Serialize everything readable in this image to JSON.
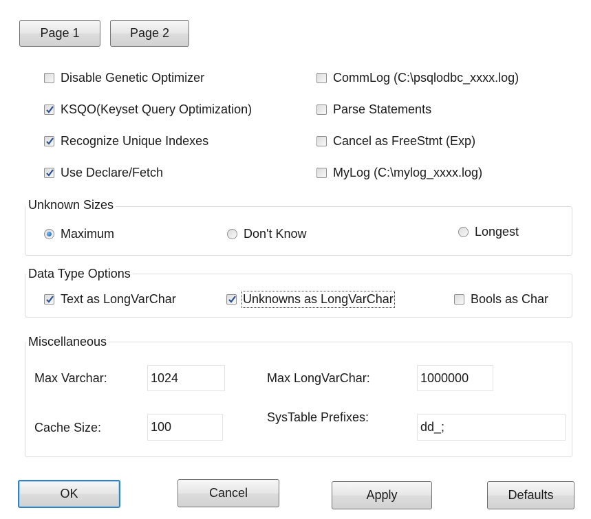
{
  "pages": {
    "page1_label": "Page 1",
    "page2_label": "Page 2"
  },
  "options": {
    "left": [
      {
        "label": "Disable Genetic Optimizer",
        "checked": false
      },
      {
        "label": "KSQO(Keyset Query Optimization)",
        "checked": true
      },
      {
        "label": "Recognize Unique Indexes",
        "checked": true
      },
      {
        "label": "Use Declare/Fetch",
        "checked": true
      }
    ],
    "right": [
      {
        "label": "CommLog (C:\\psqlodbc_xxxx.log)",
        "checked": false
      },
      {
        "label": "Parse Statements",
        "checked": false
      },
      {
        "label": "Cancel as FreeStmt (Exp)",
        "checked": false
      },
      {
        "label": "MyLog (C:\\mylog_xxxx.log)",
        "checked": false
      }
    ]
  },
  "unknown_sizes": {
    "title": "Unknown Sizes",
    "options": [
      {
        "label": "Maximum",
        "selected": true
      },
      {
        "label": "Don't Know",
        "selected": false
      },
      {
        "label": "Longest",
        "selected": false
      }
    ]
  },
  "data_type_options": {
    "title": "Data Type Options",
    "options": [
      {
        "label": "Text as LongVarChar",
        "checked": true
      },
      {
        "label": "Unknowns as LongVarChar",
        "checked": true
      },
      {
        "label": "Bools as Char",
        "checked": false
      }
    ]
  },
  "misc": {
    "title": "Miscellaneous",
    "max_varchar_label": "Max Varchar:",
    "max_varchar_value": "1024",
    "max_longvarchar_label": "Max LongVarChar:",
    "max_longvarchar_value": "1000000",
    "cache_size_label": "Cache Size:",
    "cache_size_value": "100",
    "systable_prefixes_label": "SysTable Prefixes:",
    "systable_prefixes_value": "dd_;"
  },
  "buttons": {
    "ok": "OK",
    "cancel": "Cancel",
    "apply": "Apply",
    "defaults": "Defaults"
  },
  "colors": {
    "checkmark": "#2a4f8f",
    "default_button_border": "#3c7fb1"
  }
}
